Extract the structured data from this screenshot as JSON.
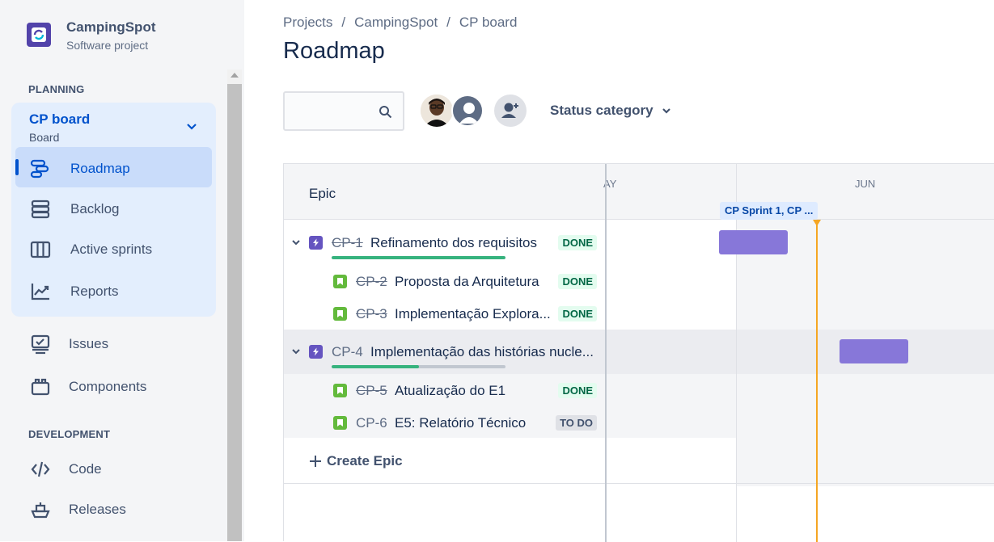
{
  "project": {
    "name": "CampingSpot",
    "type": "Software project"
  },
  "sidebar": {
    "planning_label": "PLANNING",
    "board": {
      "name": "CP board",
      "type": "Board"
    },
    "items": [
      {
        "label": "Roadmap",
        "icon": "roadmap-icon",
        "selected": true
      },
      {
        "label": "Backlog",
        "icon": "backlog-icon"
      },
      {
        "label": "Active sprints",
        "icon": "active-sprints-icon"
      },
      {
        "label": "Reports",
        "icon": "reports-icon"
      },
      {
        "label": "Issues",
        "icon": "issues-icon"
      },
      {
        "label": "Components",
        "icon": "components-icon"
      }
    ],
    "development_label": "DEVELOPMENT",
    "dev_items": [
      {
        "label": "Code",
        "icon": "code-icon"
      },
      {
        "label": "Releases",
        "icon": "releases-icon"
      }
    ]
  },
  "breadcrumbs": [
    "Projects",
    "CampingSpot",
    "CP board"
  ],
  "breadcrumb_sep": "/",
  "page_title": "Roadmap",
  "toolbar": {
    "search_placeholder": "",
    "status_filter_label": "Status category"
  },
  "roadmap": {
    "epic_column_label": "Epic",
    "months": [
      "AY",
      "JUN"
    ],
    "sprint_label": "CP Sprint 1, CP ...",
    "rows": [
      {
        "type": "epic",
        "key": "CP-1",
        "summary": "Refinamento dos requisitos",
        "status": "DONE",
        "done": true,
        "progress": 1.0
      },
      {
        "type": "story",
        "key": "CP-2",
        "summary": "Proposta da Arquitetura",
        "status": "DONE",
        "done": true
      },
      {
        "type": "story",
        "key": "CP-3",
        "summary": "Implementação Explora...",
        "status": "DONE",
        "done": true
      },
      {
        "type": "epic",
        "key": "CP-4",
        "summary": "Implementação das histórias nucle...",
        "status": "",
        "done": false,
        "progress": 0.5
      },
      {
        "type": "story",
        "key": "CP-5",
        "summary": "Atualização do E1",
        "status": "DONE",
        "done": true
      },
      {
        "type": "story",
        "key": "CP-6",
        "summary": "E5: Relatório Técnico",
        "status": "TO DO",
        "done": false
      }
    ],
    "create_label": "Create Epic"
  },
  "colors": {
    "accent": "#0052CC",
    "epic": "#6554C0",
    "story": "#63BA3C",
    "bar": "#8777D9",
    "today": "#F5A623",
    "done_green": "#36B37E"
  }
}
